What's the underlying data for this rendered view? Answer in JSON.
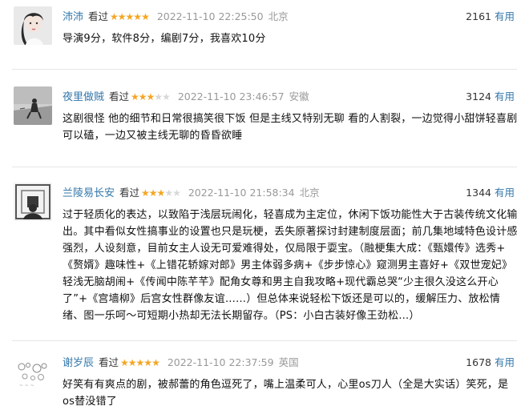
{
  "reviews": [
    {
      "username": "沛沛",
      "status": "看过",
      "stars_filled": "★★★★★",
      "stars_empty": "",
      "rating_value": 5,
      "date": "2022-11-10 22:25:50",
      "location": "北京",
      "votes": "2161",
      "useful_label": "有用",
      "text": "导演9分，软件8分，编剧7分，我喜欢10分"
    },
    {
      "username": "夜里做贼",
      "status": "看过",
      "stars_filled": "★★★",
      "stars_empty": "★★",
      "rating_value": 3,
      "date": "2022-11-10 23:46:57",
      "location": "安徽",
      "votes": "3124",
      "useful_label": "有用",
      "text": "这剧很怪 他的细节和日常很搞笑很下饭 但是主线又特别无聊 看的人割裂，一边觉得小甜饼轻喜剧可以磕，一边又被主线无聊的昏昏欲睡"
    },
    {
      "username": "兰陵易长安",
      "status": "看过",
      "stars_filled": "★★★",
      "stars_empty": "★★",
      "rating_value": 3,
      "date": "2022-11-10 21:58:34",
      "location": "北京",
      "votes": "1344",
      "useful_label": "有用",
      "text": "过于轻质化的表达，以致陷于浅层玩闹化，轻喜成为主定位，休闲下饭功能性大于古装传统文化输出。其中看似女性搞事业的设置也只是玩梗，丢失原著探讨封建制度层面；前几集地域特色设计感强烈，人设刻意，目前女主人设无可爱难得处，仅局限于耍宝。（融梗集大成：《甄嬛传》选秀+《赘婿》趣味性+《上错花轿嫁对郎》男主体弱多病+《步步惊心》窥测男主喜好+《双世宠妃》轻浅无脑胡闹+《传闻中陈芊芊》配角女尊和男主自我攻略+现代霸总哭“少主很久没这么开心了”+《宫墙柳》后宫女性群像友谊……）但总体来说轻松下饭还是可以的，缓解压力、放松情绪、图一乐呵～可短期小热却无法长期留存。（PS：小白古装好像王劲松…）"
    },
    {
      "username": "谢岁辰",
      "status": "看过",
      "stars_filled": "★★★★★",
      "stars_empty": "",
      "rating_value": 5,
      "date": "2022-11-10 22:37:59",
      "location": "英国",
      "votes": "1678",
      "useful_label": "有用",
      "text": "好笑有有爽点的剧，被郝蕾的角色逗死了，嘴上温柔可人，心里os刀人（全是大实话）笑死，是os替没错了"
    }
  ]
}
